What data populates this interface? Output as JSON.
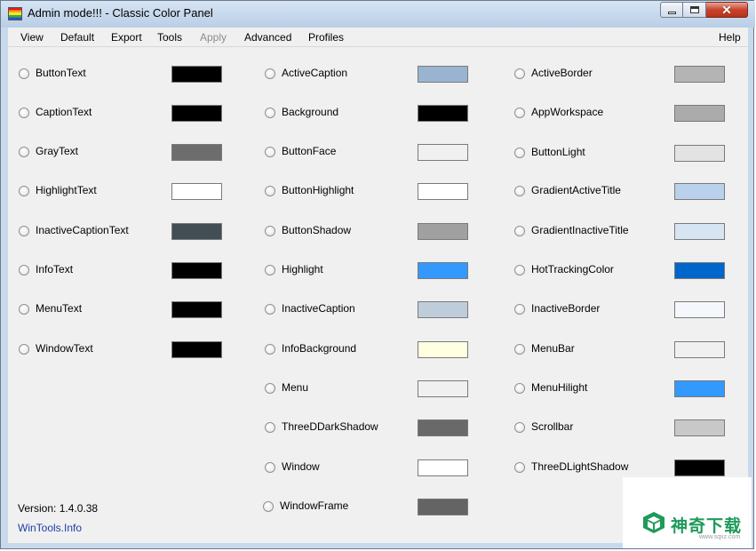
{
  "window": {
    "title": "Admin mode!!! - Classic Color Panel"
  },
  "menubar": {
    "items": [
      {
        "label": "View",
        "enabled": true
      },
      {
        "label": "Default",
        "enabled": true
      },
      {
        "label": "Export",
        "enabled": true
      },
      {
        "label": "Tools",
        "enabled": true
      },
      {
        "label": "Apply",
        "enabled": false
      },
      {
        "label": "Advanced",
        "enabled": true
      },
      {
        "label": "Profiles",
        "enabled": true
      }
    ],
    "help_label": "Help"
  },
  "columns": [
    [
      {
        "label": "ButtonText",
        "color": "#000000"
      },
      {
        "label": "CaptionText",
        "color": "#000000"
      },
      {
        "label": "GrayText",
        "color": "#6d6d6d"
      },
      {
        "label": "HighlightText",
        "color": "#ffffff"
      },
      {
        "label": "InactiveCaptionText",
        "color": "#434e54"
      },
      {
        "label": "InfoText",
        "color": "#000000"
      },
      {
        "label": "MenuText",
        "color": "#000000"
      },
      {
        "label": "WindowText",
        "color": "#000000"
      }
    ],
    [
      {
        "label": "ActiveCaption",
        "color": "#99b4d1"
      },
      {
        "label": "Background",
        "color": "#000000"
      },
      {
        "label": "ButtonFace",
        "color": "#f0f0f0"
      },
      {
        "label": "ButtonHighlight",
        "color": "#ffffff"
      },
      {
        "label": "ButtonShadow",
        "color": "#a0a0a0"
      },
      {
        "label": "Highlight",
        "color": "#3399ff"
      },
      {
        "label": "InactiveCaption",
        "color": "#bfcddb"
      },
      {
        "label": "InfoBackground",
        "color": "#ffffe1"
      },
      {
        "label": "Menu",
        "color": "#f0f0f0"
      },
      {
        "label": "ThreeDDarkShadow",
        "color": "#696969"
      },
      {
        "label": "Window",
        "color": "#ffffff"
      },
      {
        "label": "WindowFrame",
        "color": "#646464"
      }
    ],
    [
      {
        "label": "ActiveBorder",
        "color": "#b4b4b4"
      },
      {
        "label": "AppWorkspace",
        "color": "#ababab"
      },
      {
        "label": "ButtonLight",
        "color": "#e3e3e3"
      },
      {
        "label": "GradientActiveTitle",
        "color": "#b9d1ea"
      },
      {
        "label": "GradientInactiveTitle",
        "color": "#d7e4f2"
      },
      {
        "label": "HotTrackingColor",
        "color": "#0066cc"
      },
      {
        "label": "InactiveBorder",
        "color": "#f4f7fc"
      },
      {
        "label": "MenuBar",
        "color": "#f0f0f0"
      },
      {
        "label": "MenuHilight",
        "color": "#3399ff"
      },
      {
        "label": "Scrollbar",
        "color": "#c8c8c8"
      },
      {
        "label": "ThreeDLightShadow",
        "color": "#000000"
      }
    ]
  ],
  "footer": {
    "version": "Version: 1.4.0.38",
    "link": "WinTools.Info"
  },
  "watermark": {
    "text": "神奇下载",
    "sub": "www.sqxz.com",
    "color": "#1e9a5a"
  }
}
